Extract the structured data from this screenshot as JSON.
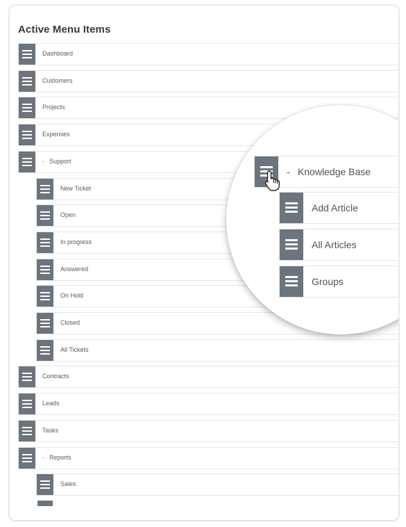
{
  "panel": {
    "title": "Active Menu Items"
  },
  "menu_items": [
    {
      "label": "Dashboard",
      "level": 0,
      "expanded": false
    },
    {
      "label": "Customers",
      "level": 0,
      "expanded": false
    },
    {
      "label": "Projects",
      "level": 0,
      "expanded": false
    },
    {
      "label": "Expenses",
      "level": 0,
      "expanded": false
    },
    {
      "label": "Support",
      "level": 0,
      "expanded": true
    },
    {
      "label": "New Ticket",
      "level": 1,
      "expanded": false
    },
    {
      "label": "Open",
      "level": 1,
      "expanded": false
    },
    {
      "label": "In progress",
      "level": 1,
      "expanded": false
    },
    {
      "label": "Answered",
      "level": 1,
      "expanded": false
    },
    {
      "label": "On Hold",
      "level": 1,
      "expanded": false
    },
    {
      "label": "Closed",
      "level": 1,
      "expanded": false
    },
    {
      "label": "All Tickets",
      "level": 1,
      "expanded": false
    },
    {
      "label": "Contracts",
      "level": 0,
      "expanded": false
    },
    {
      "label": "Leads",
      "level": 0,
      "expanded": false
    },
    {
      "label": "Tasks",
      "level": 0,
      "expanded": false
    },
    {
      "label": "Reports",
      "level": 0,
      "expanded": true
    },
    {
      "label": "Sales",
      "level": 1,
      "expanded": false
    }
  ],
  "magnifier": {
    "items": [
      {
        "label": "Knowledge Base",
        "level": 0,
        "expanded": true
      },
      {
        "label": "Add Article",
        "level": 1,
        "expanded": false
      },
      {
        "label": "All Articles",
        "level": 1,
        "expanded": false
      },
      {
        "label": "Groups",
        "level": 1,
        "expanded": false
      }
    ],
    "cursor_icon": "hand-pointer-icon"
  },
  "icons": {
    "drag_handle": "drag-handle-icon"
  },
  "colors": {
    "handle": "#6c757d",
    "row_border": "#e4e6e8",
    "title_text": "#333a40",
    "label_text": "#555b61"
  }
}
